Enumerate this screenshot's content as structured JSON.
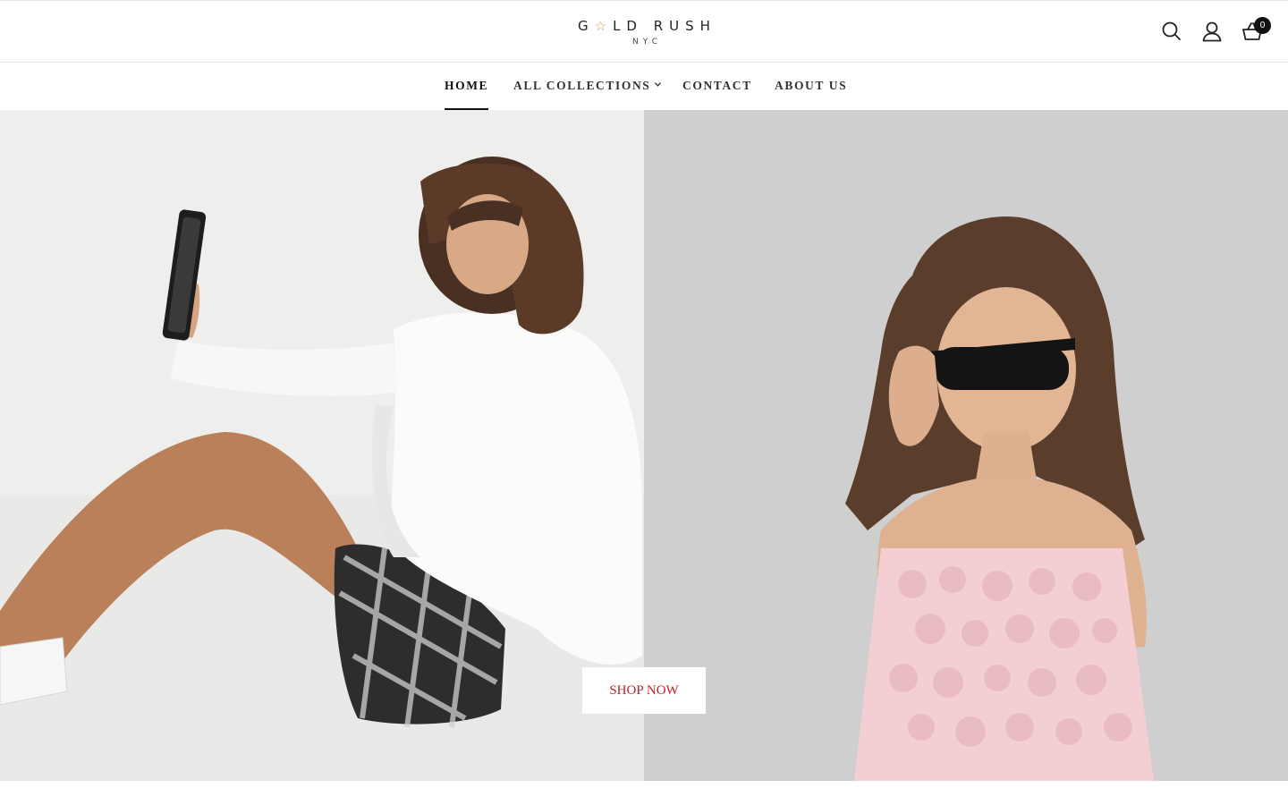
{
  "header": {
    "logo": {
      "text_before": "G",
      "star": "☆",
      "text_after": "LD RUSH",
      "subtitle": "NYC",
      "star_color": "#c8a24a"
    },
    "icons": {
      "search": "search-icon",
      "account": "user-icon",
      "cart": "basket-icon"
    },
    "cart_count": "0"
  },
  "nav": {
    "items": [
      {
        "label": "HOME",
        "active": true
      },
      {
        "label": "ALL COLLECTIONS",
        "dropdown": true
      },
      {
        "label": "CONTACT"
      },
      {
        "label": "ABOUT US"
      }
    ]
  },
  "hero": {
    "left_image": "girl in white sweatshirt and plaid skirt taking a selfie",
    "right_image": "girl in pink rosette strapless dress lowering sunglasses",
    "cta_label": "SHOP NOW",
    "cta_color": "#c0202a"
  }
}
